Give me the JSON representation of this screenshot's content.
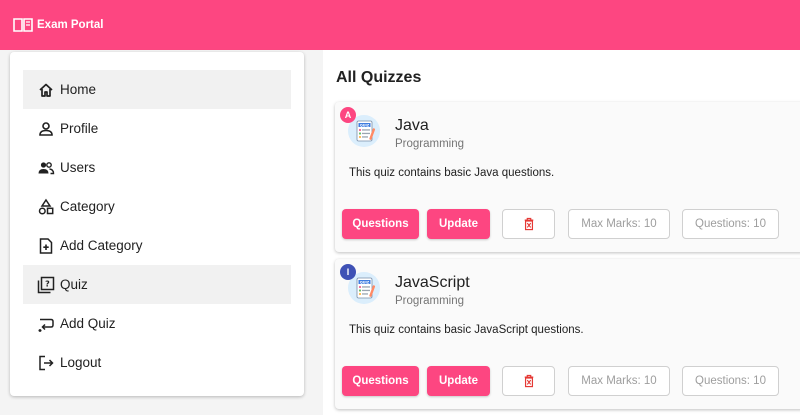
{
  "header": {
    "title": "Exam Portal",
    "icon": "book-open-icon"
  },
  "sidebar": {
    "items": [
      {
        "label": "Home",
        "icon": "home-icon",
        "active": true
      },
      {
        "label": "Profile",
        "icon": "person-icon",
        "active": false
      },
      {
        "label": "Users",
        "icon": "users-icon",
        "active": false
      },
      {
        "label": "Category",
        "icon": "category-icon",
        "active": false
      },
      {
        "label": "Add Category",
        "icon": "add-box-icon",
        "active": false
      },
      {
        "label": "Quiz",
        "icon": "quiz-icon",
        "active": true
      },
      {
        "label": "Add Quiz",
        "icon": "add-quiz-icon",
        "active": false
      },
      {
        "label": "Logout",
        "icon": "logout-icon",
        "active": false
      }
    ]
  },
  "main": {
    "title": "All Quizzes",
    "quizzes": [
      {
        "badge": "A",
        "badge_color": "#fd4681",
        "title": "Java",
        "category": "Programming",
        "description": "This quiz contains basic Java questions.",
        "questions_btn": "Questions",
        "update_btn": "Update",
        "max_marks": "Max Marks: 10",
        "num_questions": "Questions: 10"
      },
      {
        "badge": "I",
        "badge_color": "#3f51b5",
        "title": "JavaScript",
        "category": "Programming",
        "description": "This quiz contains basic JavaScript questions.",
        "questions_btn": "Questions",
        "update_btn": "Update",
        "max_marks": "Max Marks: 10",
        "num_questions": "Questions: 10"
      }
    ]
  },
  "colors": {
    "accent": "#fd4681",
    "delete": "#e53935"
  }
}
